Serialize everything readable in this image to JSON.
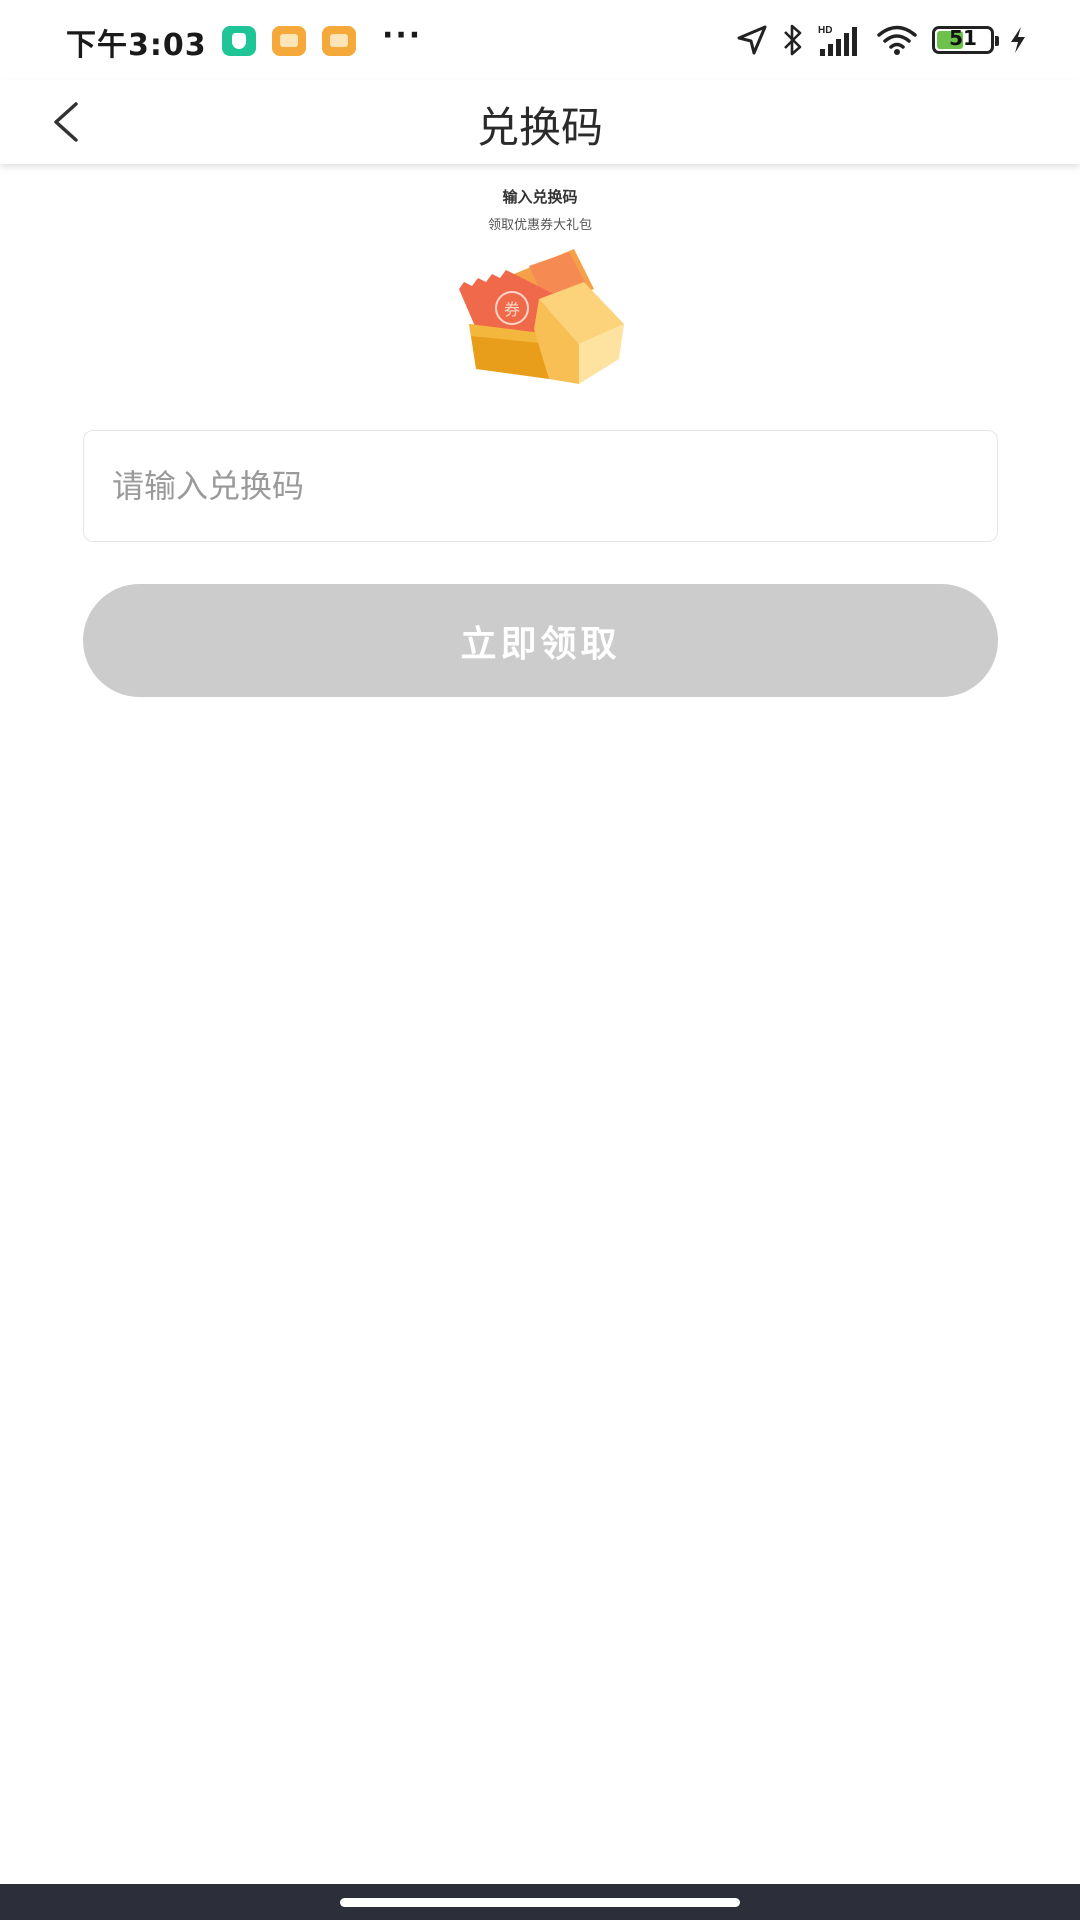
{
  "status_bar": {
    "time": "下午3:03",
    "more": "···",
    "battery_level": "51",
    "icons": [
      "shield-app-icon",
      "message-app-icon",
      "message-app-icon",
      "location-icon",
      "bluetooth-icon",
      "hd-signal-icon",
      "wifi-icon",
      "battery-icon",
      "charging-icon"
    ],
    "battery_color": "#6cc24a"
  },
  "nav": {
    "title": "兑换码",
    "back_icon": "chevron-left-icon"
  },
  "banner": {
    "title": "输入兑换码",
    "subtitle": "领取优惠券大礼包",
    "coupon_text": "券"
  },
  "form": {
    "placeholder": "请输入兑换码",
    "value": "",
    "submit_label": "立即领取",
    "submit_color": "#cccccc"
  },
  "colors": {
    "accent_orange": "#f4a93a",
    "coupon_red": "#f0694a",
    "bottom_bar": "#2c2f3a"
  }
}
